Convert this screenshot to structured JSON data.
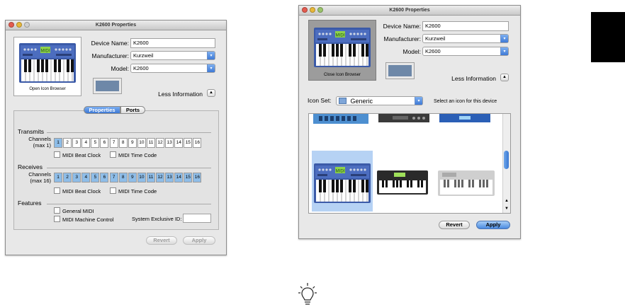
{
  "colors": {
    "accent": "#4a8ae0",
    "selected_channel": "#8ebde8",
    "black_tab": "#000000"
  },
  "left_window": {
    "title": "K2600 Properties",
    "icon_caption": "Open Icon Browser",
    "device_name_label": "Device Name:",
    "device_name_value": "K2600",
    "manufacturer_label": "Manufacturer:",
    "manufacturer_value": "Kurzweil",
    "model_label": "Model:",
    "model_value": "K2600",
    "less_info_label": "Less Information",
    "tabs": [
      {
        "label": "Properties",
        "active": true
      },
      {
        "label": "Ports",
        "active": false
      }
    ],
    "transmits": {
      "heading": "Transmits",
      "channels_label": "Channels",
      "channels_sub": "(max 1)",
      "channels": [
        "1",
        "2",
        "3",
        "4",
        "5",
        "6",
        "7",
        "8",
        "9",
        "10",
        "11",
        "12",
        "13",
        "14",
        "15",
        "16"
      ],
      "beat_clock": "MIDI Beat Clock",
      "time_code": "MIDI Time Code"
    },
    "receives": {
      "heading": "Receives",
      "channels_label": "Channels",
      "channels_sub": "(max 16)",
      "channels": [
        "1",
        "2",
        "3",
        "4",
        "5",
        "6",
        "7",
        "8",
        "9",
        "10",
        "11",
        "12",
        "13",
        "14",
        "15",
        "16"
      ],
      "beat_clock": "MIDI Beat Clock",
      "time_code": "MIDI Time Code"
    },
    "features": {
      "heading": "Features",
      "general_midi": "General MIDI",
      "machine_control": "MIDI Machine Control",
      "sysex_label": "System Exclusive ID:",
      "sysex_value": ""
    },
    "revert_label": "Revert",
    "apply_label": "Apply"
  },
  "right_window": {
    "title": "K2600 Properties",
    "icon_caption": "Close Icon Browser",
    "device_name_label": "Device Name:",
    "device_name_value": "K2600",
    "manufacturer_label": "Manufacturer:",
    "manufacturer_value": "Kurzweil",
    "model_label": "Model:",
    "model_value": "K2600",
    "less_info_label": "Less Information",
    "icon_set_label": "Icon Set:",
    "icon_set_value": "Generic",
    "hint": "Select an icon for this device",
    "revert_label": "Revert",
    "apply_label": "Apply"
  }
}
